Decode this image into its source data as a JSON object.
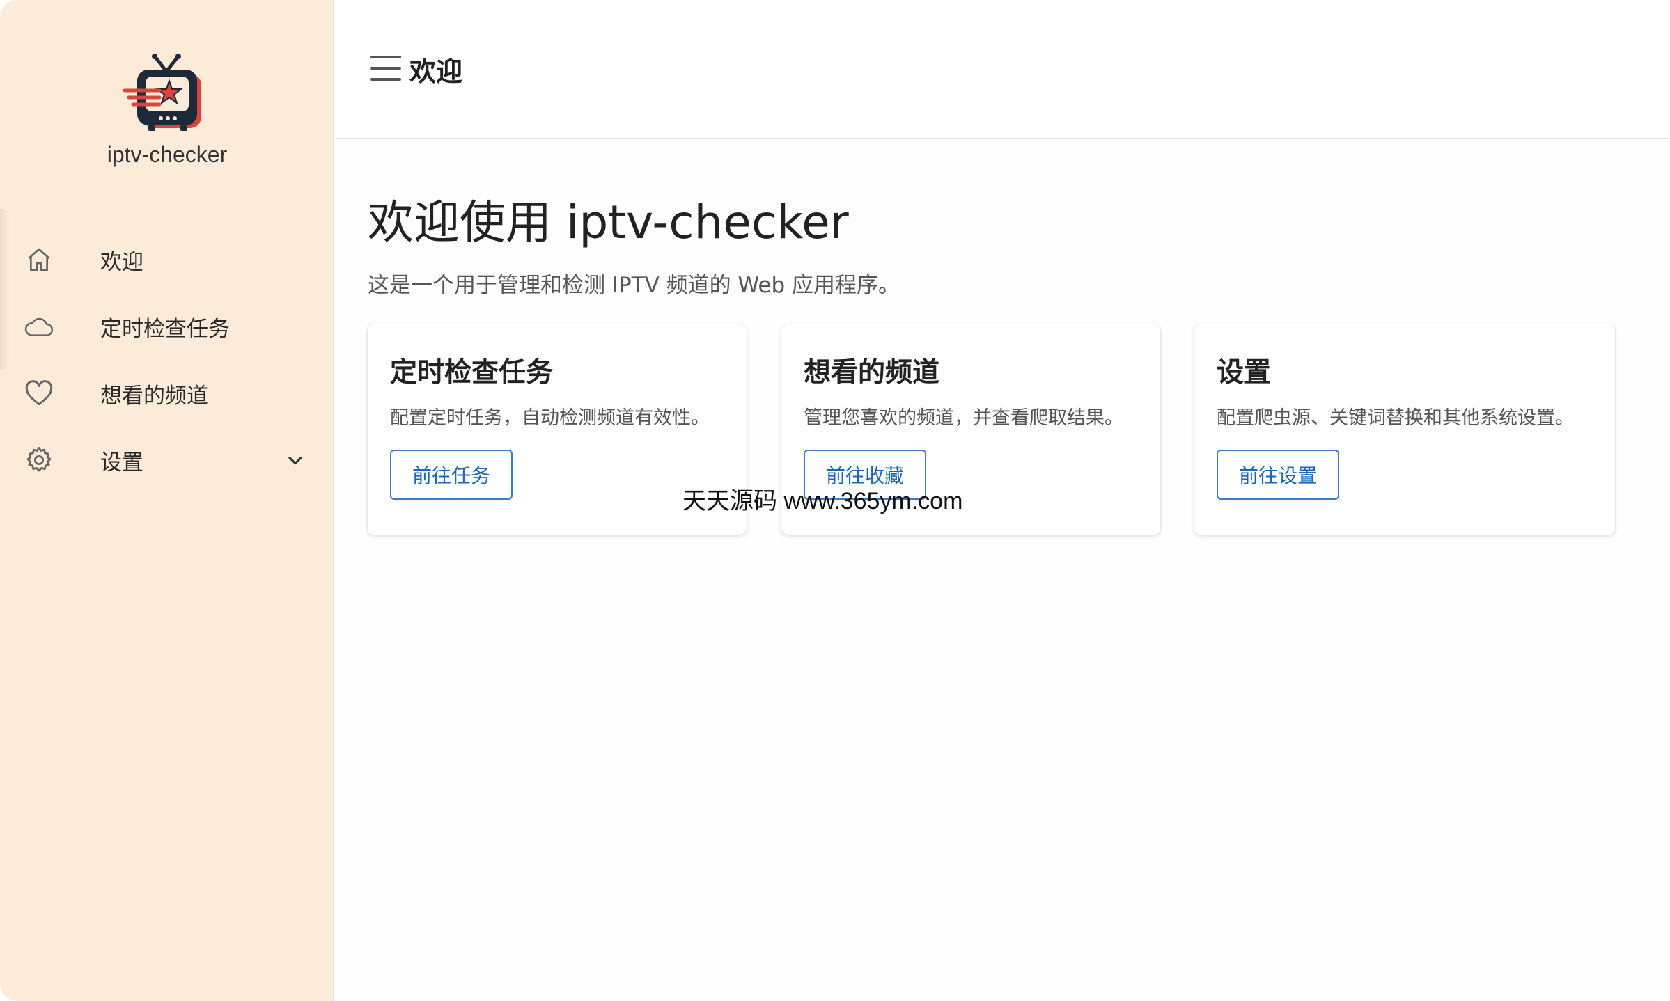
{
  "app": {
    "name": "iptv-checker"
  },
  "sidebar": {
    "items": [
      {
        "label": "欢迎",
        "icon": "home-icon"
      },
      {
        "label": "定时检查任务",
        "icon": "cloud-icon"
      },
      {
        "label": "想看的频道",
        "icon": "heart-icon"
      },
      {
        "label": "设置",
        "icon": "gear-icon",
        "expandable": true
      }
    ]
  },
  "header": {
    "title": "欢迎"
  },
  "main": {
    "title": "欢迎使用 iptv-checker",
    "subtitle": "这是一个用于管理和检测 IPTV 频道的 Web 应用程序。",
    "cards": [
      {
        "title": "定时检查任务",
        "description": "配置定时任务，自动检测频道有效性。",
        "button": "前往任务"
      },
      {
        "title": "想看的频道",
        "description": "管理您喜欢的频道，并查看爬取结果。",
        "button": "前往收藏"
      },
      {
        "title": "设置",
        "description": "配置爬虫源、关键词替换和其他系统设置。",
        "button": "前往设置"
      }
    ]
  },
  "watermark": "天天源码 www.365ym.com",
  "colors": {
    "sidebar_bg": "#fbebd8",
    "accent": "#1e66b8",
    "logo_dark": "#1d2a3a",
    "logo_red": "#d9453a"
  }
}
